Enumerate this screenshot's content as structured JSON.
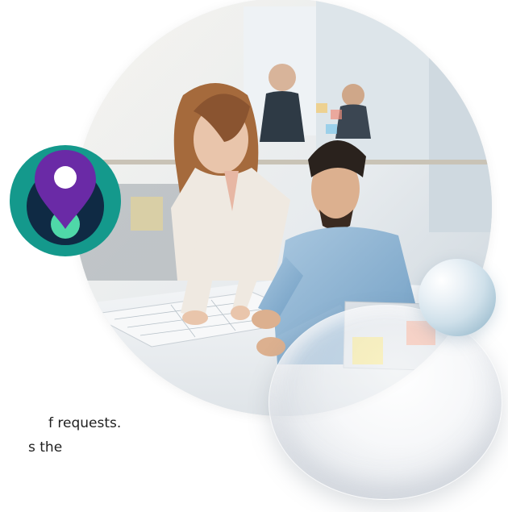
{
  "text_fragment": {
    "line1": "f requests.",
    "line2": "s the"
  },
  "photo": {
    "alt": "Two coworkers reviewing blueprints at a desk in a bright office"
  },
  "icons": {
    "pin": "location-pin-icon"
  },
  "colors": {
    "badge_teal": "#14998c",
    "badge_navy": "#0f2a44",
    "pin_purple": "#6a2aa6",
    "pin_mint": "#4fd8a8",
    "orb_blue": "#a9c6d6",
    "text_dark": "#1f1f1f"
  }
}
